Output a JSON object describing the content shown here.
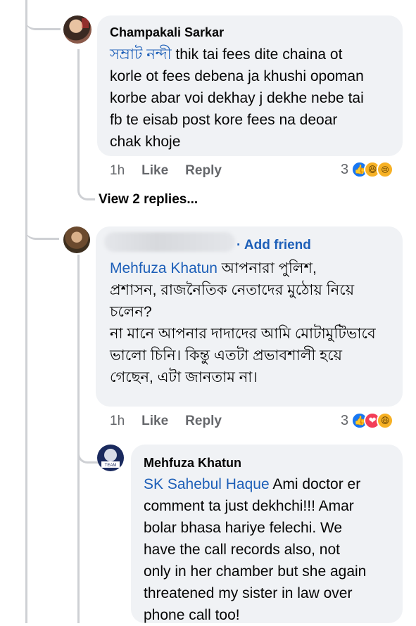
{
  "comments": [
    {
      "author": "Champakali Sarkar",
      "mention": "সম্রাট নন্দী",
      "lines": [
        " thik tai fees dite chaina ot",
        "korle ot fees debena ja khushi opoman",
        "korbe abar voi dekhay j dekhe nebe tai",
        "fb te eisab post kore fees na deoar",
        "chak khoje"
      ],
      "time": "1h",
      "like": "Like",
      "reply": "Reply",
      "reaction_count": "3",
      "reactions": [
        "like",
        "haha",
        "sad"
      ],
      "view_replies": "View 2 replies..."
    },
    {
      "author_hidden": true,
      "add_friend": "· Add friend",
      "mention": "Mehfuza Khatun",
      "lines": [
        " আপনারা পুলিশ,",
        "প্রশাসন, রাজনৈতিক নেতাদের মুঠোয় নিয়ে",
        "চলেন?",
        "না মানে আপনার দাদাদের আমি মোটামুটিভাবে",
        "ভালো চিনি। কিন্তু এতটা প্রভাবশালী হয়ে",
        "গেছেন, এটা জানতাম না।"
      ],
      "time": "1h",
      "like": "Like",
      "reply": "Reply",
      "reaction_count": "3",
      "reactions": [
        "like",
        "love",
        "haha"
      ]
    },
    {
      "author": "Mehfuza Khatun",
      "mention": "SK Sahebul Haque",
      "lines": [
        " Ami doctor er",
        "comment ta just dekhchi!!! Amar",
        "bolar bhasa hariye felechi. We",
        "have the call records also, not",
        "only in her chamber but she again",
        "threatened my sister in law over",
        "phone call too!"
      ],
      "avatar_text": "TEAM"
    }
  ]
}
